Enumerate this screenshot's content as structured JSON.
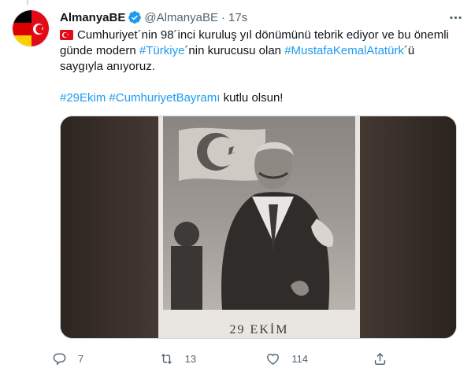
{
  "author": {
    "name": "AlmanyaBE",
    "handle": "@AlmanyaBE",
    "separator": "·",
    "time": "17s"
  },
  "tweet": {
    "flag_icon": "turkey-flag-icon",
    "line1_text": "Cumhuriyet´nin 98´inci kuruluş yıl dönümünü tebrik ediyor ve bu önemli günde modern ",
    "hashtag_turkiye": "#Türkiye",
    "line1_mid": "´nin kurucusu olan ",
    "hashtag_ataturk": "#MustafaKemalAtatürk",
    "line1_end": "´ü saygıyla anıyoruz.",
    "hashtag_29ekim": "#29Ekim",
    "hashtag_bayram": "#CumhuriyetBayramı",
    "line2_end": " kutlu olsun!"
  },
  "media": {
    "caption": "29 EKİM"
  },
  "actions": {
    "reply_count": "7",
    "retweet_count": "13",
    "like_count": "114"
  },
  "colors": {
    "link": "#1d9bf0",
    "muted": "#536471",
    "verified": "#1d9bf0",
    "turkey_red": "#e30a17"
  }
}
